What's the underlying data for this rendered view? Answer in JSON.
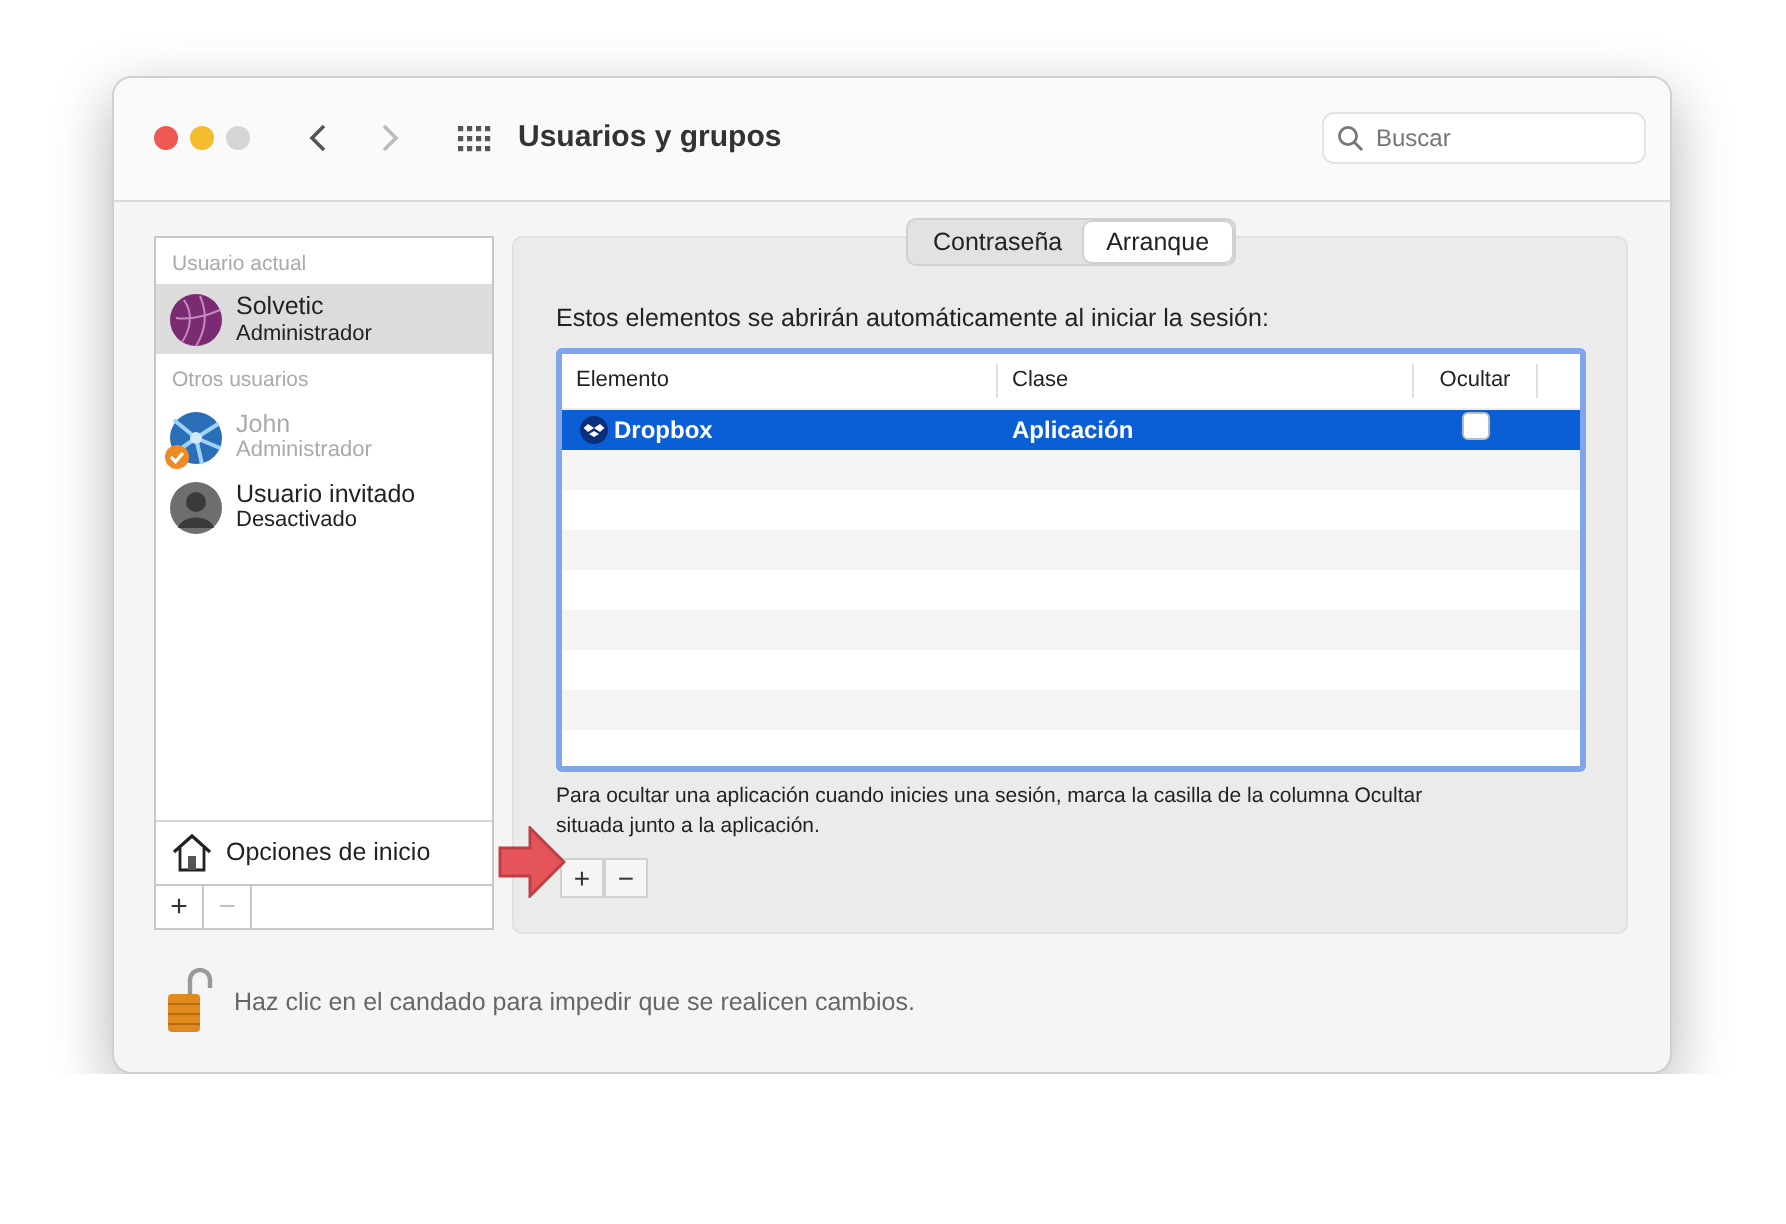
{
  "window": {
    "title": "Usuarios y grupos",
    "search": {
      "placeholder": "Buscar"
    }
  },
  "sidebar": {
    "sections": [
      {
        "heading": "Usuario actual",
        "users": [
          {
            "name": "Solvetic",
            "role": "Administrador",
            "kind": "sphere",
            "badge": false,
            "disabled": false,
            "selected": true
          }
        ]
      },
      {
        "heading": "Otros usuarios",
        "users": [
          {
            "name": "John",
            "role": "Administrador",
            "kind": "burst",
            "badge": true,
            "disabled": true,
            "selected": false
          },
          {
            "name": "Usuario invitado",
            "role": "Desactivado",
            "kind": "guest",
            "badge": false,
            "disabled": false,
            "selected": false
          }
        ]
      }
    ],
    "login_options": "Opciones de inicio",
    "buttons": [
      {
        "label": "+",
        "disabled": false
      },
      {
        "label": "−",
        "disabled": true
      }
    ]
  },
  "tabs": [
    {
      "label": "Contraseña",
      "selected": false
    },
    {
      "label": "Arranque",
      "selected": true
    }
  ],
  "startup": {
    "intro": "Estos elementos se abrirán automáticamente al iniciar la sesión:",
    "table": {
      "columns": [
        "Elemento",
        "Clase",
        "Ocultar"
      ],
      "rows": [
        {
          "item": "Dropbox",
          "class": "Aplicación",
          "hide": false,
          "selected": true
        }
      ]
    },
    "note": "Para ocultar una aplicación cuando inicies una sesión, marca la casilla de la columna Ocultar situada junto a la aplicación.",
    "buttons": [
      {
        "label": "+",
        "disabled": false
      },
      {
        "label": "−",
        "disabled": false
      }
    ]
  },
  "lock": {
    "locked": false,
    "text": "Haz clic en el candado para impedir que se realicen cambios."
  }
}
